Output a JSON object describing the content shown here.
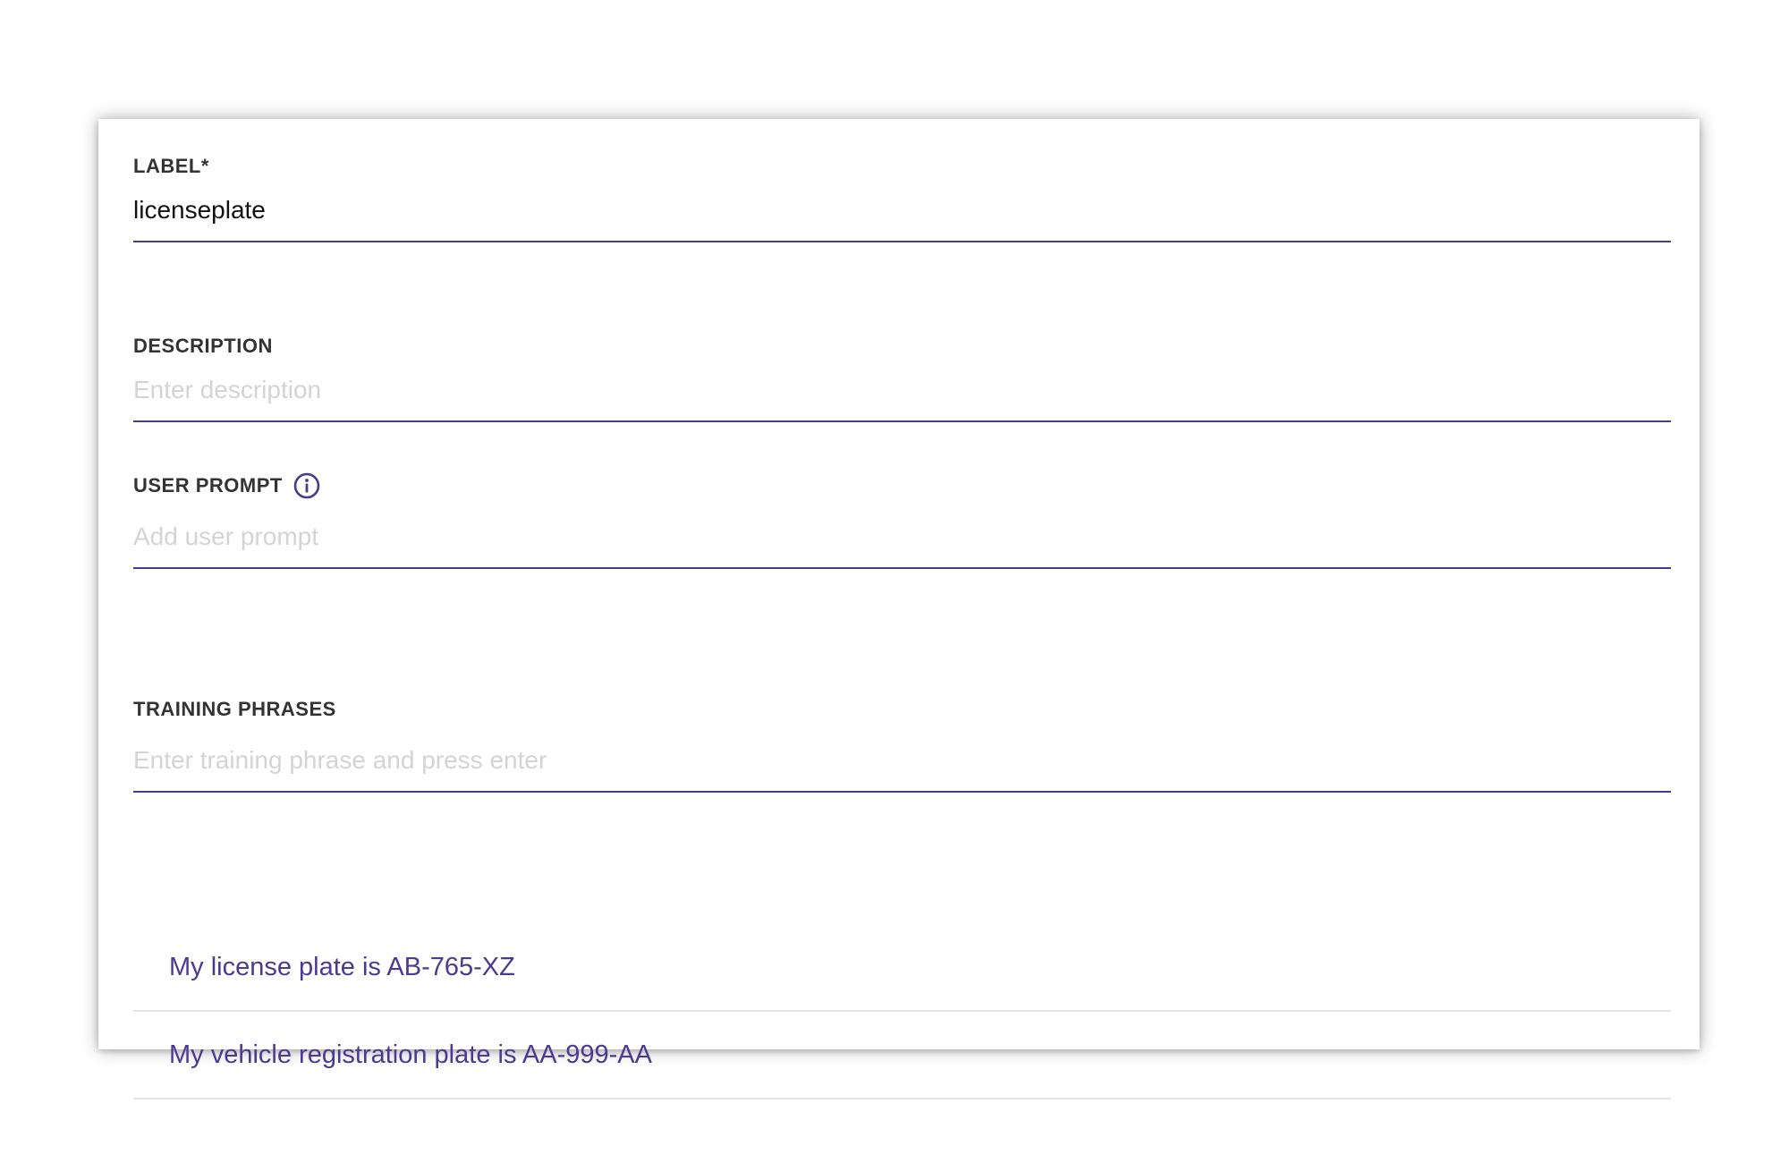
{
  "form": {
    "label_field": {
      "label": "LABEL*",
      "value": "licenseplate"
    },
    "description_field": {
      "label": "DESCRIPTION",
      "placeholder": "Enter description",
      "value": ""
    },
    "user_prompt_field": {
      "label": "USER PROMPT",
      "info_icon": "info-icon",
      "placeholder": "Add user prompt",
      "value": ""
    },
    "training_phrases_field": {
      "label": "TRAINING PHRASES",
      "placeholder": "Enter training phrase and press enter",
      "value": ""
    },
    "phrases": [
      {
        "text": "My license plate is AB-765-XZ"
      },
      {
        "text": "My vehicle registration plate is AA-999-AA"
      }
    ]
  },
  "colors": {
    "accent": "#4a3a8c",
    "phrase_text": "#4b3a8f",
    "label_text": "#333333",
    "placeholder": "#d4d4d4",
    "divider": "#e4e4e4"
  }
}
